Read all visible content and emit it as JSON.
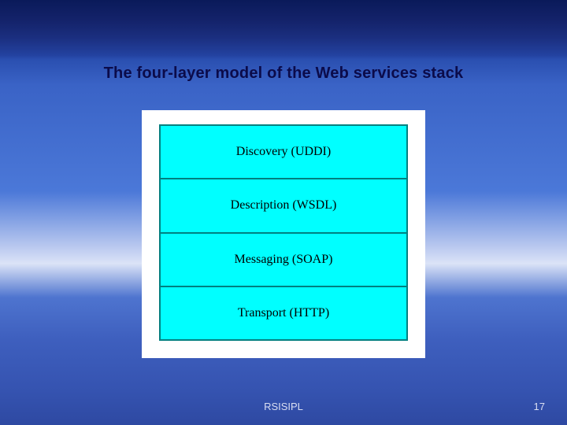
{
  "slide": {
    "title": "The four-layer model of the Web services stack",
    "footer_name": "RSISIPL",
    "page_number": "17"
  },
  "stack": {
    "layers": [
      {
        "label": "Discovery (UDDI)"
      },
      {
        "label": "Description (WSDL)"
      },
      {
        "label": "Messaging (SOAP)"
      },
      {
        "label": "Transport (HTTP)"
      }
    ]
  }
}
